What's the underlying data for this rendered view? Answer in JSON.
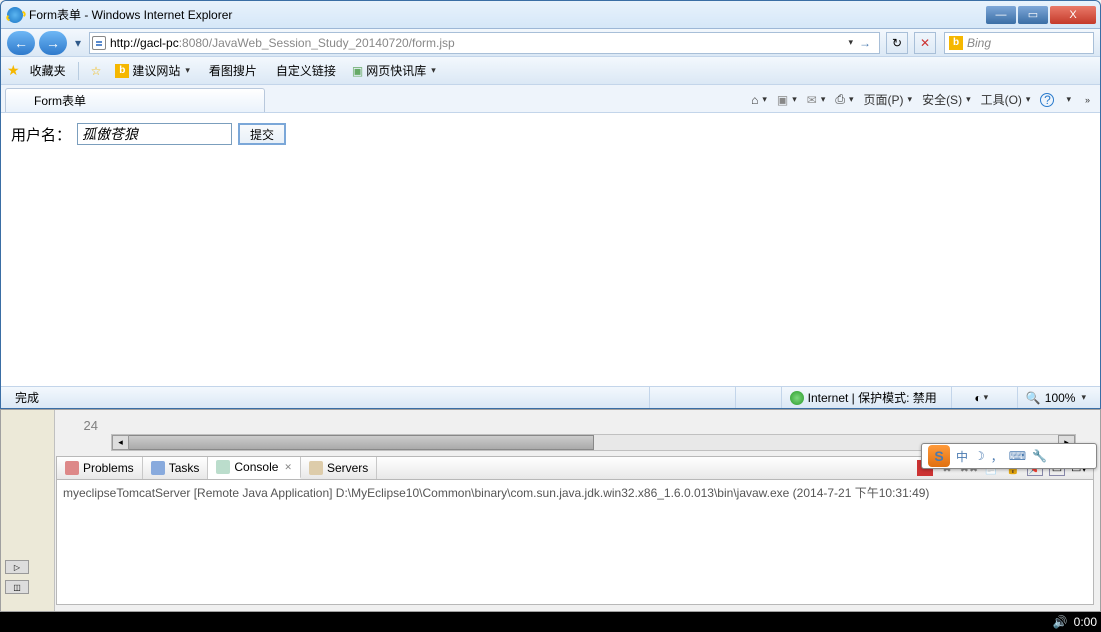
{
  "window": {
    "title": "Form表单 - Windows Internet Explorer",
    "min": "—",
    "max": "▭",
    "close": "X"
  },
  "nav": {
    "back": "←",
    "fwd": "→",
    "recent": "▾",
    "url_host": "http://gacl-pc",
    "url_port": ":8080",
    "url_path": "/JavaWeb_Session_Study_20140720/form.jsp",
    "go": "→",
    "refresh": "↻",
    "stop": "✕",
    "search_icon": "b",
    "search_placeholder": "Bing"
  },
  "favbar": {
    "favorites": "收藏夹",
    "items": [
      "建议网站",
      "看图搜片",
      "自定义链接",
      "网页快讯库"
    ]
  },
  "tab": {
    "title": "Form表单"
  },
  "commandbar": {
    "home": "⌂",
    "rss": "▣",
    "mail": "✉",
    "print": "⎙",
    "page": "页面(P)",
    "safety": "安全(S)",
    "tools": "工具(O)",
    "help": "?"
  },
  "form": {
    "label": "用户名：",
    "value": "孤傲苍狼",
    "submit": "提交"
  },
  "statusbar": {
    "done": "完成",
    "zone": "Internet | 保护模式: 禁用",
    "zoom": "100%"
  },
  "eclipse": {
    "lineno": "24",
    "tabs": [
      "Problems",
      "Tasks",
      "Console",
      "Servers"
    ],
    "active_tab": 2,
    "console_line": "myeclipseTomcatServer [Remote Java Application] D:\\MyEclipse10\\Common\\binary\\com.sun.java.jdk.win32.x86_1.6.0.013\\bin\\javaw.exe (2014-7-21 下午10:31:49)"
  },
  "ime": {
    "logo": "S",
    "mode": "中",
    "moon": "☽",
    "comma": "，",
    "keyboard": "⌨",
    "wrench": "🔧"
  },
  "taskbar": {
    "time": "0:00"
  }
}
